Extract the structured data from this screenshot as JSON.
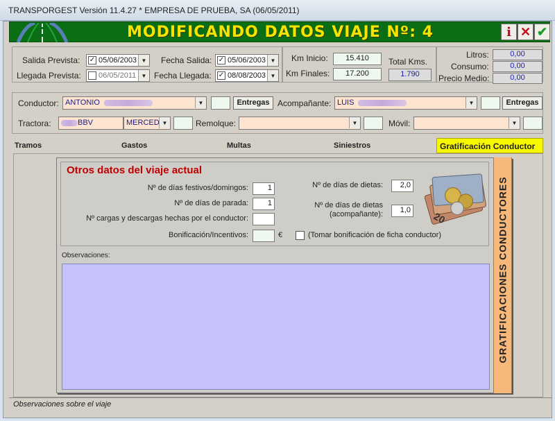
{
  "window": {
    "title": "TRANSPORGEST Versión 11.4.27 * EMPRESA DE PRUEBA, SA (06/05/2011)"
  },
  "banner": {
    "title": "MODIFICANDO DATOS VIAJE Nº: 4",
    "info_label": "i",
    "close_label": "✕",
    "ok_label": "✔"
  },
  "dates": {
    "salida_prevista_label": "Salida Prevista:",
    "salida_prevista_value": "05/06/2003",
    "salida_prevista_checked": "✓",
    "llegada_prevista_label": "Llegada Prevista:",
    "llegada_prevista_value": "06/05/2011",
    "llegada_prevista_checked": "",
    "fecha_salida_label": "Fecha Salida:",
    "fecha_salida_value": "05/06/2003",
    "fecha_salida_checked": "✓",
    "fecha_llegada_label": "Fecha Llegada:",
    "fecha_llegada_value": "08/08/2003",
    "fecha_llegada_checked": "✓"
  },
  "km": {
    "inicio_label": "Km Inicio:",
    "inicio_value": "15.410",
    "finales_label": "Km Finales:",
    "finales_value": "17.200",
    "total_label": "Total Kms.",
    "total_value": "1.790"
  },
  "fuel": {
    "litros_label": "Litros:",
    "litros_value": "0,00",
    "consumo_label": "Consumo:",
    "consumo_value": "0,00",
    "precio_label": "Precio Medio:",
    "precio_value": "0,00"
  },
  "people": {
    "conductor_label": "Conductor:",
    "conductor_value": "ANTONIO",
    "acompanante_label": "Acompañante:",
    "acompanante_value": "LUIS",
    "entregas_label": "Entregas"
  },
  "vehicles": {
    "tractora_label": "Tractora:",
    "tractora_value": "BBV",
    "tractora_marca": "MERCED",
    "remolque_label": "Remolque:",
    "remolque_value": "",
    "movil_label": "Móvil:",
    "movil_value": ""
  },
  "tabs": [
    {
      "label": "Tramos"
    },
    {
      "label": "Gastos"
    },
    {
      "label": "Multas"
    },
    {
      "label": "Siniestros"
    },
    {
      "label": "Gratificación Conductor"
    }
  ],
  "panel": {
    "section_title": "Otros datos del viaje actual",
    "festivos_label": "Nº de días festivos/domingos:",
    "festivos_value": "1",
    "parada_label": "Nº de días de parada:",
    "parada_value": "1",
    "cargas_label": "Nº cargas y descargas hechas por el conductor:",
    "cargas_value": "",
    "bonificacion_label": "Bonificación/Incentivos:",
    "bonificacion_value": "",
    "currency": "€",
    "tomar_label": "(Tomar bonificación de ficha conductor)",
    "dietas_label": "Nº de días de dietas:",
    "dietas_value": "2,0",
    "dietas_acomp_label1": "Nº de días de dietas",
    "dietas_acomp_label2": "(acompañante):",
    "dietas_acomp_value": "1,0",
    "observaciones_label": "Observaciones:",
    "side_title": "GRATIFICACIONES CONDUCTORES"
  },
  "statusbar": {
    "text": "Observaciones sobre el viaje"
  }
}
